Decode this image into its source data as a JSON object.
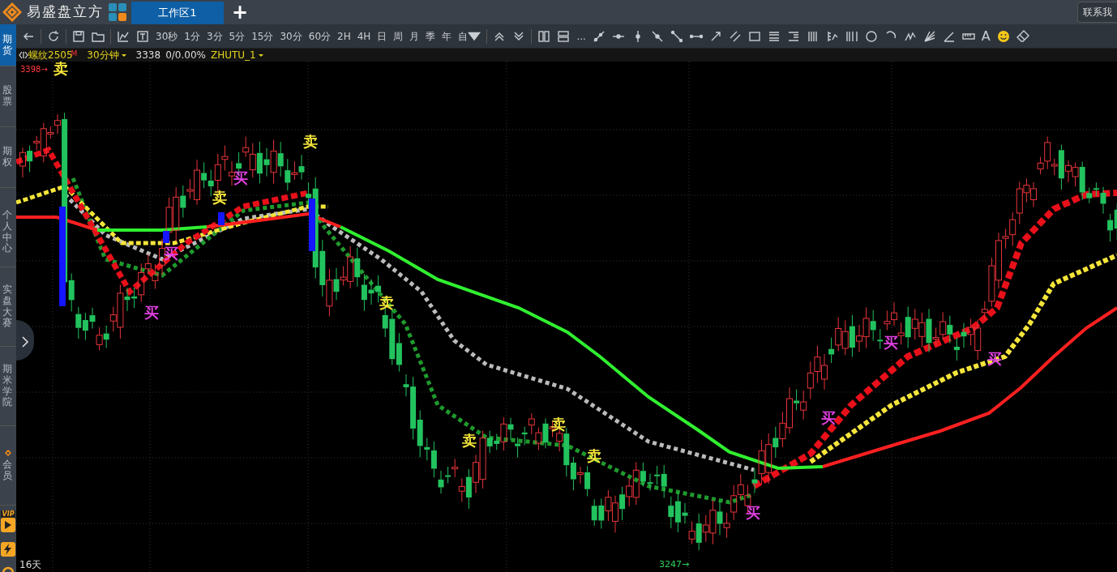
{
  "app": {
    "title": "易盛盘立方",
    "contact_label": "联系我"
  },
  "tabs": [
    {
      "label": "工作区1",
      "selected": true
    }
  ],
  "add_tab_label": "+",
  "sidebar": {
    "items": [
      {
        "label": "期货",
        "selected": true
      },
      {
        "label": "股票",
        "selected": false
      },
      {
        "label": "期权",
        "selected": false
      },
      {
        "label": "个人中心",
        "selected": false
      },
      {
        "label": "实盘大赛",
        "selected": false
      },
      {
        "label": "期米学院",
        "selected": false
      },
      {
        "label": "会员",
        "selected": false
      }
    ],
    "vip_label": "VIP"
  },
  "toolbar": {
    "periods": [
      "30秒",
      "1分",
      "3分",
      "5分",
      "15分",
      "30分",
      "60分",
      "2H",
      "4H",
      "日",
      "周",
      "月",
      "季",
      "年"
    ],
    "custom_label": "自",
    "more_label": "...",
    "text_tool_label": "A"
  },
  "info_bar": {
    "symbol": "螺纹2505",
    "symbol_mark": "M",
    "period": "30分钟",
    "price": "3338",
    "change": "0/0.00%",
    "template": "ZHUTU_1"
  },
  "chart": {
    "high_label": "3398→",
    "low_label": "3247→",
    "range_label": "16天",
    "signals": [
      {
        "kind": "sell",
        "text": "卖"
      },
      {
        "kind": "buy",
        "text": "买"
      },
      {
        "kind": "sell",
        "text": "卖"
      },
      {
        "kind": "sell",
        "text": "卖"
      },
      {
        "kind": "buy",
        "text": "买"
      },
      {
        "kind": "buy",
        "text": "买"
      },
      {
        "kind": "sell",
        "text": "卖"
      },
      {
        "kind": "sell",
        "text": "卖"
      },
      {
        "kind": "sell",
        "text": "卖"
      },
      {
        "kind": "sell",
        "text": "卖"
      },
      {
        "kind": "buy",
        "text": "买"
      },
      {
        "kind": "buy",
        "text": "买"
      },
      {
        "kind": "buy",
        "text": "买"
      },
      {
        "kind": "buy",
        "text": "买"
      }
    ]
  }
}
